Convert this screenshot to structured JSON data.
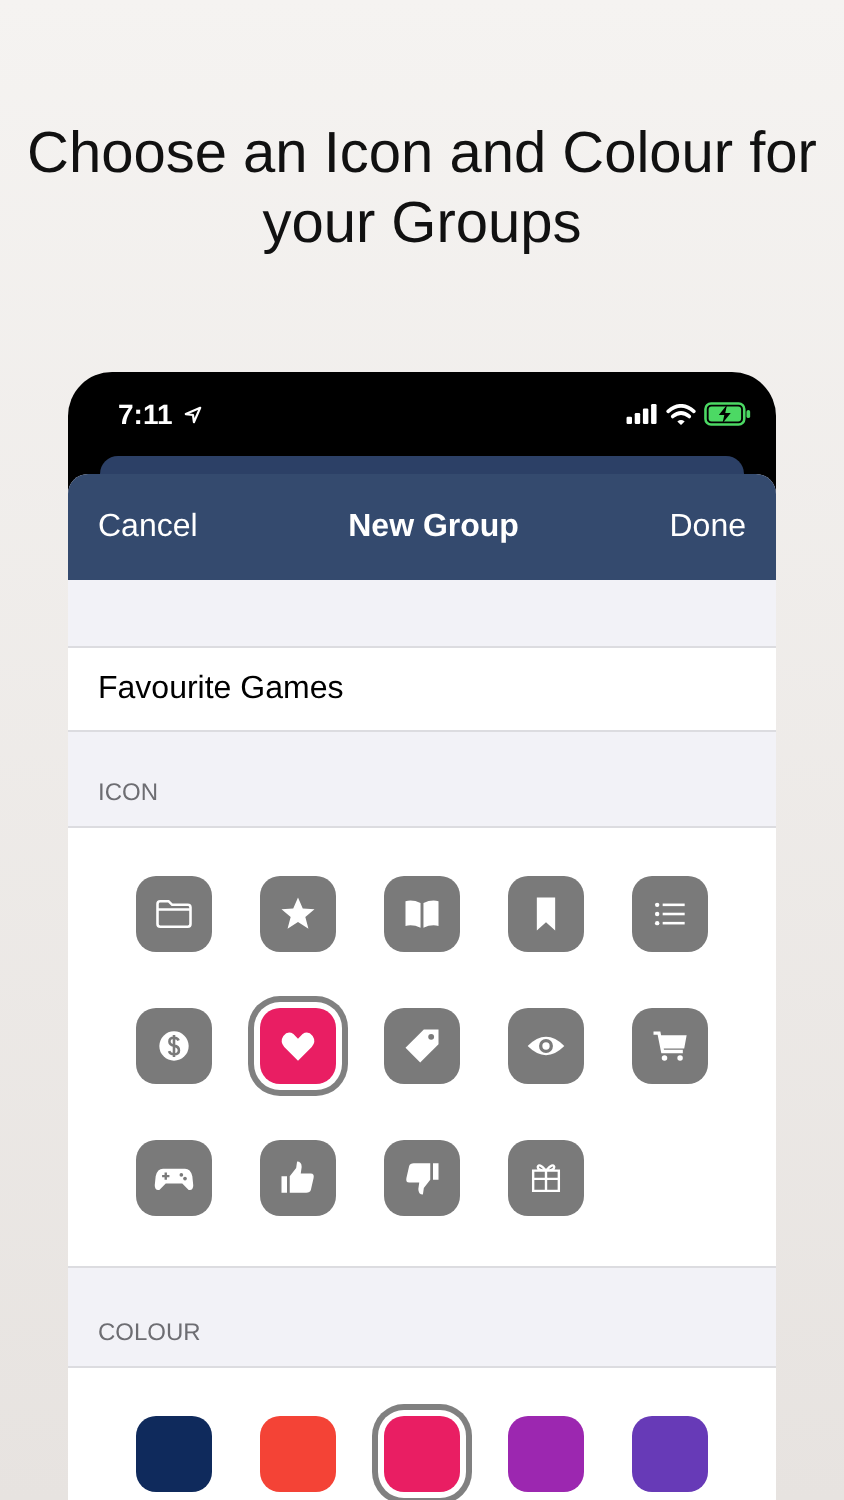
{
  "headline": "Choose an Icon and Colour for your Groups",
  "status_bar": {
    "time": "7:11"
  },
  "nav": {
    "cancel": "Cancel",
    "title": "New Group",
    "done": "Done"
  },
  "name_field": {
    "value": "Favourite Games"
  },
  "icon_section": {
    "header": "ICON",
    "icons": [
      {
        "kind": "folder",
        "selected": false
      },
      {
        "kind": "star",
        "selected": false
      },
      {
        "kind": "book",
        "selected": false
      },
      {
        "kind": "bookmark",
        "selected": false
      },
      {
        "kind": "list",
        "selected": false
      },
      {
        "kind": "dollar",
        "selected": false
      },
      {
        "kind": "heart",
        "selected": true
      },
      {
        "kind": "tag",
        "selected": false
      },
      {
        "kind": "eye",
        "selected": false
      },
      {
        "kind": "cart",
        "selected": false
      },
      {
        "kind": "gamepad",
        "selected": false
      },
      {
        "kind": "thumbs-up",
        "selected": false
      },
      {
        "kind": "thumbs-down",
        "selected": false
      },
      {
        "kind": "gift",
        "selected": false
      }
    ]
  },
  "colour_section": {
    "header": "COLOUR",
    "colours": [
      {
        "color": "#0f2a5c",
        "selected": false
      },
      {
        "color": "#f44336",
        "selected": false
      },
      {
        "color": "#e91e63",
        "selected": true
      },
      {
        "color": "#9c27b0",
        "selected": false
      },
      {
        "color": "#673ab7",
        "selected": false
      }
    ]
  }
}
